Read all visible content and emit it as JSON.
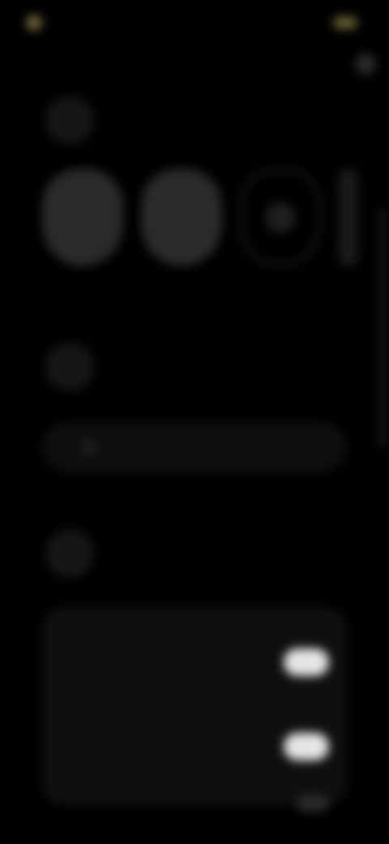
{
  "status_bar": {
    "time": "",
    "icons": "",
    "dot_color": "#6e5f3c",
    "battery_color": "#6a6433"
  },
  "header": {
    "icon": "earbuds-icon",
    "title": "",
    "subtitle": ""
  },
  "devices": [
    {
      "label": "",
      "icon": "earbud-left-icon",
      "style": "filled"
    },
    {
      "label": "",
      "icon": "earbud-right-icon",
      "style": "filled"
    },
    {
      "label": "",
      "icon": "case-icon",
      "style": "outline"
    }
  ],
  "sound_section": {
    "icon": "sound-icon",
    "title": "",
    "subtitle": ""
  },
  "action_pill": {
    "icon": "equalizer-icon",
    "label": ""
  },
  "controls_section": {
    "icon": "touch-icon",
    "title": "",
    "subtitle": ""
  },
  "settings": [
    {
      "title": "",
      "subtitle": "",
      "toggle_on": true
    },
    {
      "title": "",
      "subtitle": "",
      "toggle_on": true
    },
    {
      "title": "",
      "subtitle": "",
      "toggle_on": false
    }
  ],
  "colors": {
    "background": "#000000",
    "card": "#0f0f0f",
    "toggle_on": "#e5e5e5",
    "tile": "#2a2a2a"
  }
}
